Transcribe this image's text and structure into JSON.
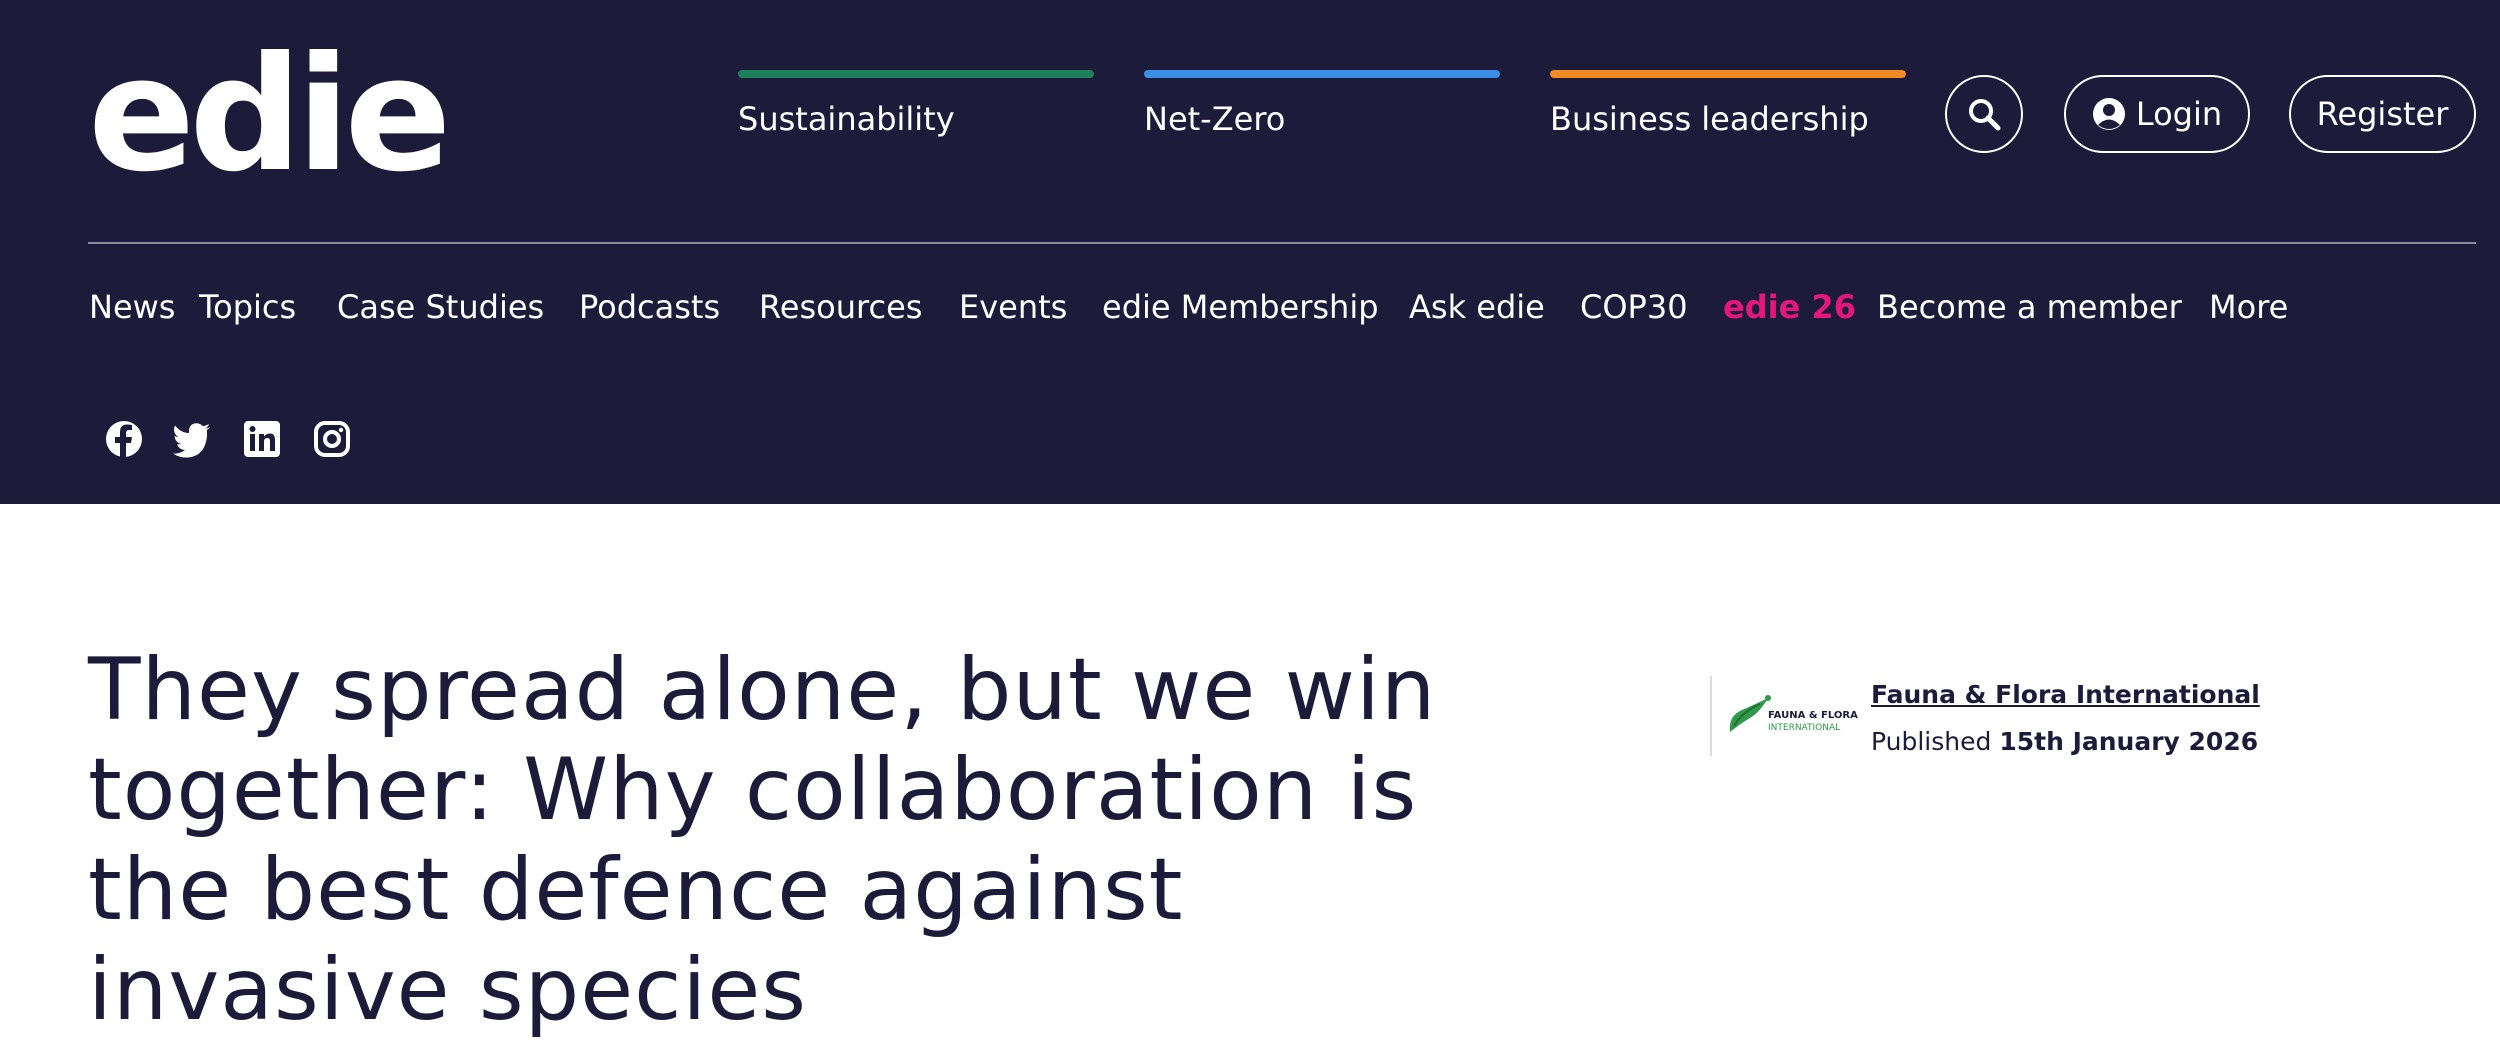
{
  "header": {
    "logo_text": "edie",
    "pillars": [
      {
        "label": "Sustainability",
        "color": "#1a7f5a"
      },
      {
        "label": "Net-Zero",
        "color": "#3a8ee6"
      },
      {
        "label": "Business leadership",
        "color": "#f08a24"
      }
    ],
    "search_icon": "search-icon",
    "login_label": "Login",
    "register_label": "Register",
    "background_color": "#1c1c3a"
  },
  "nav": {
    "items": [
      {
        "label": "News"
      },
      {
        "label": "Topics"
      },
      {
        "label": "Case Studies"
      },
      {
        "label": "Podcasts"
      },
      {
        "label": "Resources"
      },
      {
        "label": "Events"
      },
      {
        "label": "edie Membership"
      },
      {
        "label": "Ask edie"
      },
      {
        "label": "COP30"
      },
      {
        "label": "edie 26",
        "highlight_color": "#e6177a"
      },
      {
        "label": "Become a member"
      },
      {
        "label": "More"
      }
    ],
    "social": [
      "facebook-icon",
      "twitter-icon",
      "linkedin-icon",
      "instagram-icon"
    ]
  },
  "article": {
    "title": "They spread alone, but we win together: Why collaboration is the best defence against invasive species",
    "author": {
      "logo_text_line1": "FAUNA & FLORA",
      "logo_text_line2": "INTERNATIONAL",
      "name": "Fauna & Flora International"
    },
    "published_prefix": "Published",
    "published_date": "15th January 2026"
  }
}
